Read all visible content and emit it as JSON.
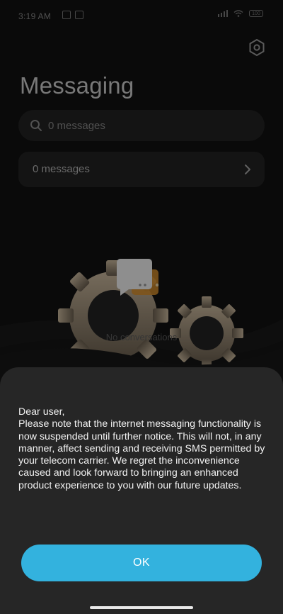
{
  "status_bar": {
    "time": "3:19 AM",
    "battery": "100"
  },
  "header": {
    "title": "Messaging",
    "settings_icon": "hexagon-settings-icon"
  },
  "search": {
    "placeholder": "0 messages",
    "icon": "search-icon"
  },
  "list": {
    "row_label": "0 messages",
    "row_icon": "chevron-right-icon"
  },
  "empty_state": {
    "label": "No conversations",
    "illustration": "gears-chat-bubble-illustration"
  },
  "dialog": {
    "message": "Dear user,\nPlease note that the internet messaging functionality is now suspended until further notice. This will not, in any manner, affect sending and receiving SMS permitted by your telecom carrier. We regret the inconvenience caused and look forward to bringing an enhanced product experience to you with our future updates.",
    "ok_label": "OK"
  },
  "colors": {
    "background": "#121212",
    "sheet": "#262626",
    "accent": "#33b2de",
    "field": "#232323"
  }
}
